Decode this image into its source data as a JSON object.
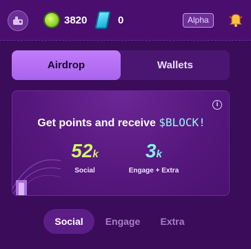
{
  "header": {
    "points_value": "3820",
    "tickets_value": "0",
    "badge_label": "Alpha"
  },
  "tabs": [
    {
      "label": "Airdrop",
      "active": true
    },
    {
      "label": "Wallets",
      "active": false
    }
  ],
  "card": {
    "headline": "Get points and receive",
    "token": "$BLOCK!",
    "info_glyph": "i",
    "stats": [
      {
        "value": "52",
        "unit": "k",
        "label": "Social"
      },
      {
        "value": "3",
        "unit": "k",
        "label": "Engage + Extra"
      }
    ]
  },
  "subtabs": [
    {
      "label": "Social",
      "active": true
    },
    {
      "label": "Engage",
      "active": false
    },
    {
      "label": "Extra",
      "active": false
    }
  ],
  "colors": {
    "background": "#3b0c5a",
    "accent": "#b06ef2",
    "social_value": "#d3f26a",
    "engage_value": "#86f0ea"
  }
}
